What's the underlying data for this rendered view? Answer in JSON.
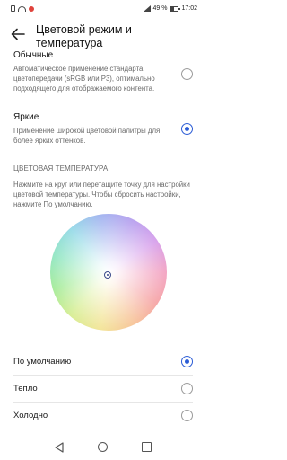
{
  "status_bar": {
    "battery": "49 %",
    "time": "17:02"
  },
  "header": {
    "title": "Цветовой режим и температура"
  },
  "color_modes": [
    {
      "title": "Обычные",
      "description": "Автоматическое применение стандарта цветопередачи (sRGB или P3), оптимально подходящего для отображаемого контента.",
      "selected": false
    },
    {
      "title": "Яркие",
      "description": "Применение широкой цветовой палитры для более ярких оттенков.",
      "selected": true
    }
  ],
  "temperature": {
    "section_header": "ЦВЕТОВАЯ ТЕМПЕРАТУРА",
    "description": "Нажмите на круг или перетащите точку для настройки цветовой температуры. Чтобы сбросить настройки, нажмите По умолчанию.",
    "options": [
      {
        "label": "По умолчанию",
        "selected": true
      },
      {
        "label": "Тепло",
        "selected": false
      },
      {
        "label": "Холодно",
        "selected": false
      }
    ]
  },
  "colors": {
    "accent": "#2b5cd6"
  }
}
